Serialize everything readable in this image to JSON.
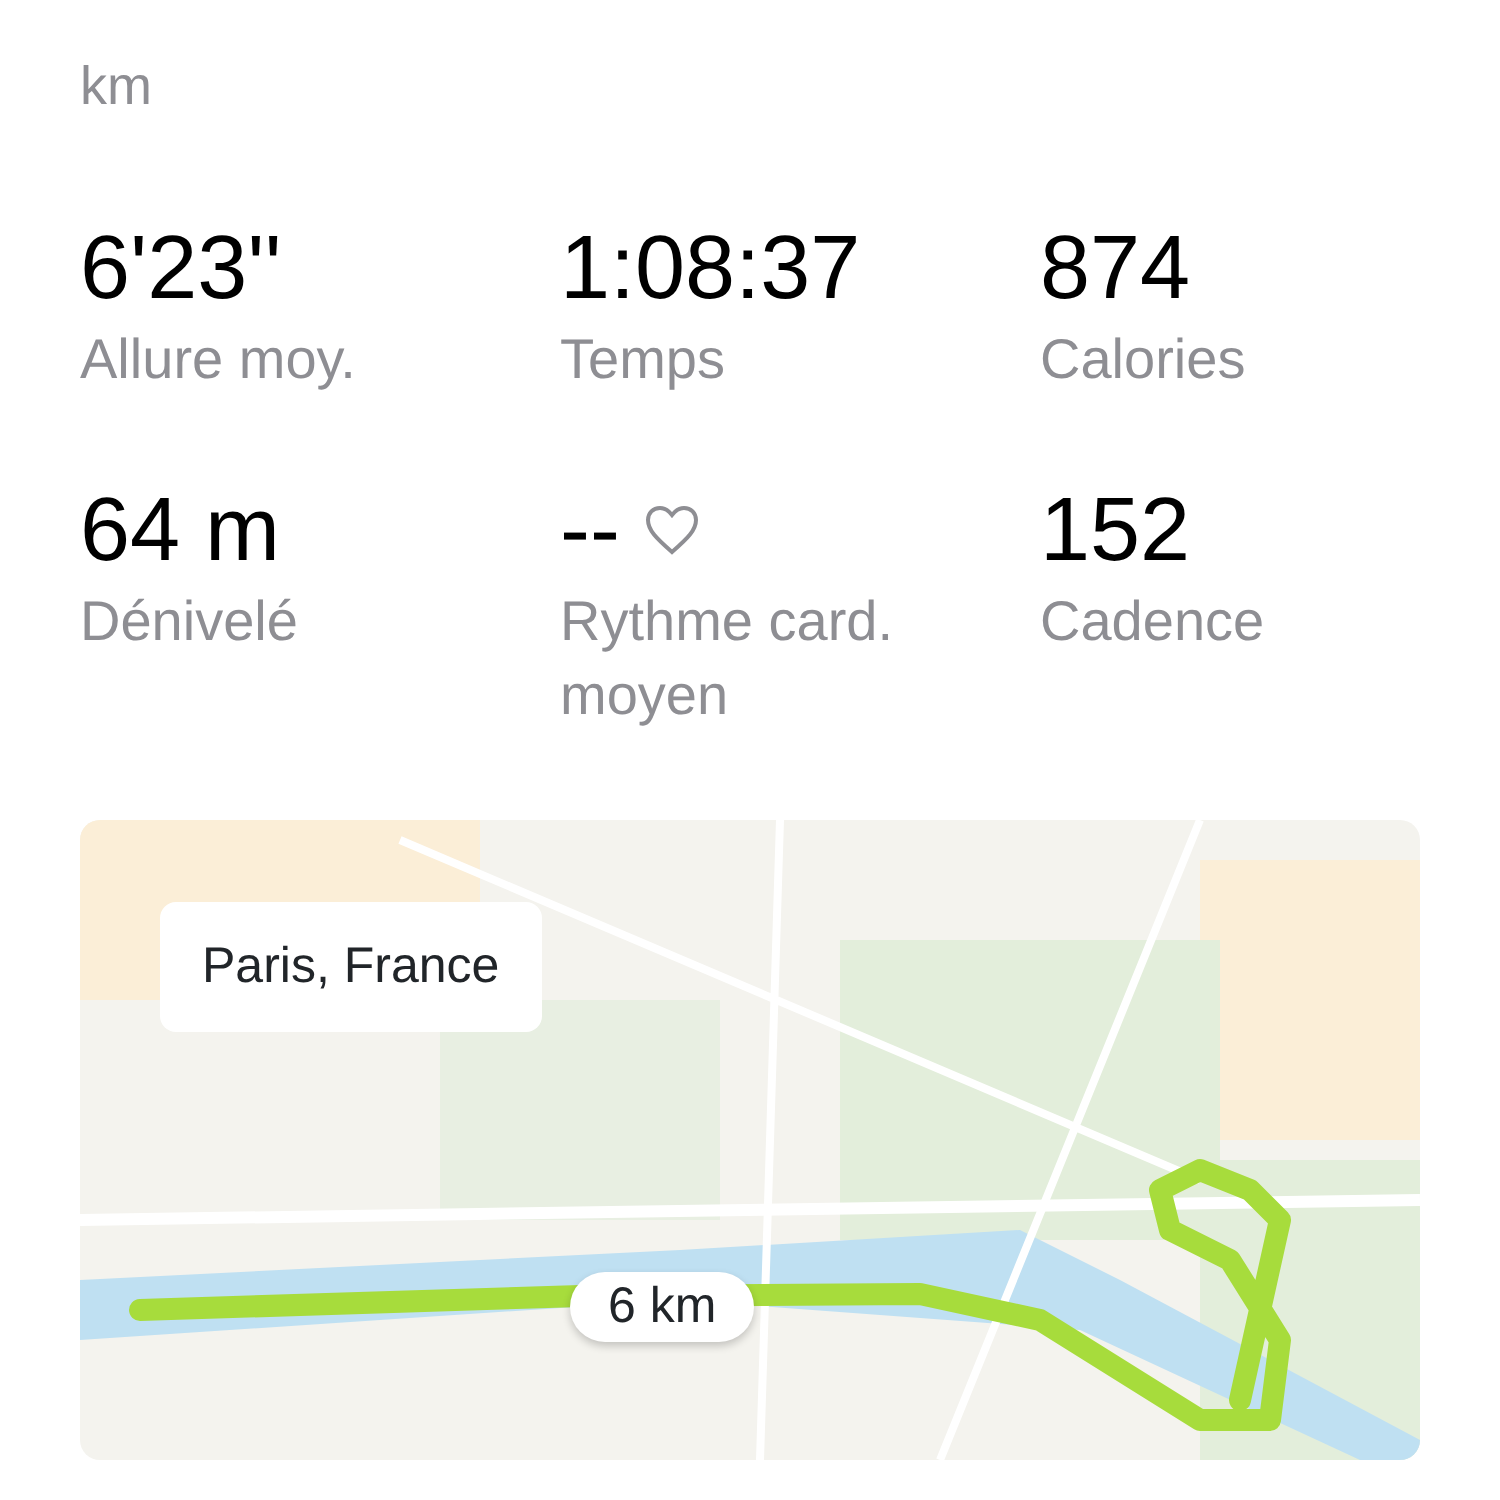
{
  "distance": {
    "unit": "km"
  },
  "stats": [
    {
      "value": "6'23''",
      "label": "Allure moy.",
      "kind": "plain"
    },
    {
      "value": "1:08:37",
      "label": "Temps",
      "kind": "plain"
    },
    {
      "value": "874",
      "label": "Calories",
      "kind": "plain"
    },
    {
      "value": "64 m",
      "label": "Dénivelé",
      "kind": "plain"
    },
    {
      "value": "--",
      "label": "Rythme card. moyen",
      "kind": "heart-rate"
    },
    {
      "value": "152",
      "label": "Cadence",
      "kind": "plain"
    }
  ],
  "map": {
    "kind": "picture",
    "location": "Paris, France",
    "marker": "6 km"
  }
}
